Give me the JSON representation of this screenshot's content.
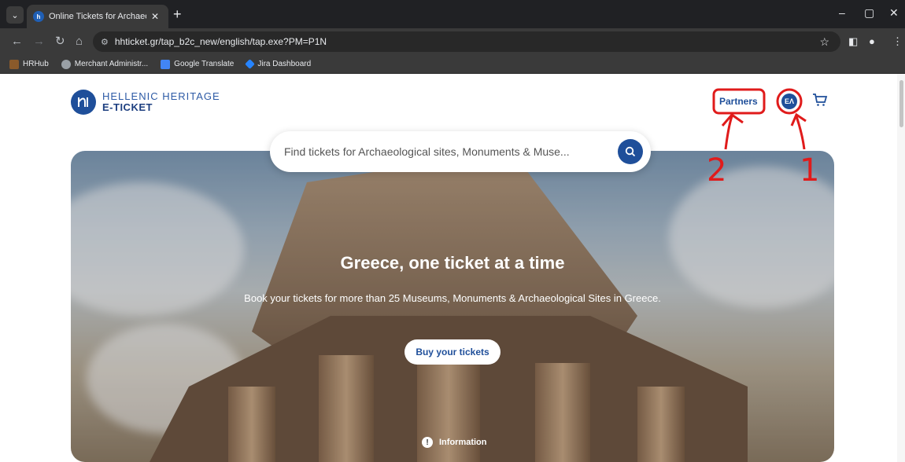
{
  "browser": {
    "tab_title": "Online Tickets for Archaeologic",
    "url": "hhticket.gr/tap_b2c_new/english/tap.exe?PM=P1N",
    "bookmarks": [
      {
        "label": "HRHub",
        "color": "#8a5a2b"
      },
      {
        "label": "Merchant Administr...",
        "color": "#9aa0a6"
      },
      {
        "label": "Google Translate",
        "color": "#4285f4"
      },
      {
        "label": "Jira Dashboard",
        "color": "#2684ff"
      }
    ]
  },
  "header": {
    "logo_line1": "HELLENIC HERITAGE",
    "logo_line2": "E-TICKET",
    "partners_label": "Partners",
    "lang_label": "ΕΛ"
  },
  "search": {
    "placeholder": "Find tickets for Archaeological sites, Monuments & Muse..."
  },
  "hero": {
    "title": "Greece, one ticket at a time",
    "subtitle": "Book your tickets for more than 25 Museums, Monuments & Archaeological Sites in Greece.",
    "cta_label": "Buy your tickets",
    "info_label": "Information"
  },
  "annotations": {
    "label_2": "2",
    "label_1": "1",
    "color": "#e01b1b"
  },
  "colors": {
    "brand": "#1f4f9a",
    "chrome_dark": "#202124",
    "chrome_toolbar": "#3a3a3a"
  }
}
